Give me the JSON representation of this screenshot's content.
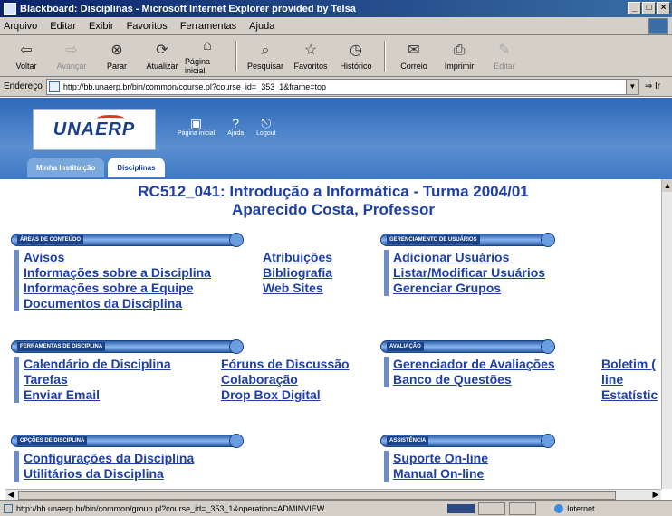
{
  "window": {
    "title": "Blackboard: Disciplinas - Microsoft Internet Explorer provided by Telsa",
    "controls": [
      "_",
      "□",
      "×"
    ]
  },
  "menu": [
    "Arquivo",
    "Editar",
    "Exibir",
    "Favoritos",
    "Ferramentas",
    "Ajuda"
  ],
  "toolbar": {
    "back": "Voltar",
    "forward": "Avançar",
    "stop": "Parar",
    "refresh": "Atualizar",
    "home": "Página inicial",
    "search": "Pesquisar",
    "favorites": "Favoritos",
    "history": "Histórico",
    "mail": "Correio",
    "print": "Imprimir",
    "edit": "Editar"
  },
  "address": {
    "label": "Endereço",
    "url": "http://bb.unaerp.br/bin/common/course.pl?course_id=_353_1&frame=top",
    "go": "Ir"
  },
  "header": {
    "logo": "UNAERP",
    "icons": [
      {
        "name": "home-icon",
        "label": "Página inicial"
      },
      {
        "name": "help-icon",
        "label": "Ajuda"
      },
      {
        "name": "logout-icon",
        "label": "Logout"
      }
    ],
    "tabs": [
      {
        "label": "Minha Instituição",
        "active": false
      },
      {
        "label": "Disciplinas",
        "active": true
      }
    ]
  },
  "course": {
    "title": "RC512_041: Introdução a Informática - Turma 2004/01",
    "instructor": "Aparecido Costa, Professor"
  },
  "sections": {
    "content_areas": {
      "title": "ÁREAS DE CONTEÚDO",
      "col1": [
        "Avisos",
        "Informações sobre a Disciplina",
        "Informações sobre a Equipe",
        "Documentos da Disciplina"
      ],
      "col2": [
        "Atribuições",
        "Bibliografia",
        "Web Sites"
      ]
    },
    "user_management": {
      "title": "GERENCIAMENTO DE USUÁRIOS",
      "links": [
        "Adicionar Usuários",
        "Listar/Modificar Usuários",
        "Gerenciar Grupos"
      ]
    },
    "course_tools": {
      "title": "FERRAMENTAS DE DISCIPLINA",
      "col1": [
        "Calendário de Disciplina",
        "Tarefas",
        "Enviar Email"
      ],
      "col2": [
        "Fóruns de Discussão",
        "Colaboração",
        "Drop Box Digital"
      ]
    },
    "assessment": {
      "title": "AVALIAÇÃO",
      "col1": [
        "Gerenciador de Avaliações",
        "Banco de Questões"
      ],
      "col2": [
        "Boletim (",
        "line",
        "Estatístic"
      ]
    },
    "course_options": {
      "title": "OPÇÕES DE DISCIPLINA",
      "links": [
        "Configurações da Disciplina",
        "Utilitários da Disciplina"
      ]
    },
    "assistance": {
      "title": "ASSISTÊNCIA",
      "links": [
        "Suporte On-line",
        "Manual On-line"
      ]
    }
  },
  "status": {
    "text": "http://bb.unaerp.br/bin/common/group.pl?course_id=_353_1&operation=ADMINVIEW",
    "zone": "Internet"
  },
  "colors": {
    "link": "#1f3fa8",
    "header_blue": "#2e68b8",
    "section_bar": "#2d5da8"
  }
}
